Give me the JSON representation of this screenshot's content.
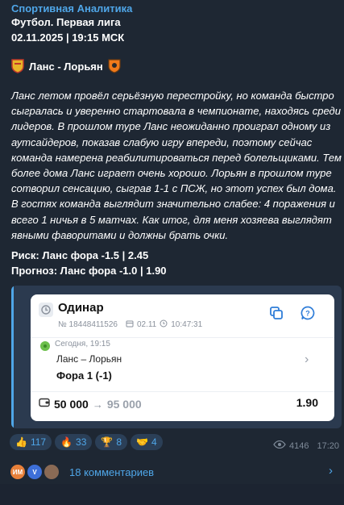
{
  "post": {
    "channel": "Спортивная Аналитика",
    "league": "Футбол. Первая лига",
    "datetime": "02.11.2025 | 19:15 МСК",
    "match": "Ланс - Лорьян",
    "body": "Ланс летом провёл серьёзную перестройку, но команда быстро сыгралась и уверенно стартовала в чемпионате, находясь среди лидеров. В прошлом туре Ланс неожиданно проиграл одному из аутсайдеров, показав слабую игру впереди, поэтому сейчас команда намерена реабилитироваться перед болельщиками. Тем более дома Ланс играет очень хорошо. Лорьян в прошлом туре сотворил сенсацию, сыграв 1-1 с ПСЖ, но этот успех был дома. В гостях команда выглядит значительно слабее: 4 поражения и всего 1 ничья в 5 матчах. Как итог, для меня хозяева выглядят явными фаворитами и должны брать очки.",
    "risk": "Риск: Ланс фора -1.5 | 2.45",
    "forecast": "Прогноз: Ланс фора -1.0 | 1.90"
  },
  "coupon": {
    "title": "Одинар",
    "number": "№ 18448411526",
    "date": "02.11",
    "time": "10:47:31",
    "event_time": "Сегодня, 19:15",
    "teams": "Ланс – Лорьян",
    "bet": "Фора 1 (-1)",
    "stake": "50 000",
    "payout": "95 000",
    "odds": "1.90"
  },
  "reactions": [
    {
      "emoji": "👍",
      "count": "117"
    },
    {
      "emoji": "🔥",
      "count": "33"
    },
    {
      "emoji": "🏆",
      "count": "8"
    },
    {
      "emoji": "🤝",
      "count": "4"
    }
  ],
  "meta": {
    "views": "4146",
    "time": "17:20"
  },
  "comments": {
    "label": "18 комментариев",
    "avatars": [
      "ИМ",
      "V"
    ]
  },
  "colors": {
    "accent": "#4fa6e8",
    "background": "#1e2733",
    "card": "#ffffff"
  }
}
